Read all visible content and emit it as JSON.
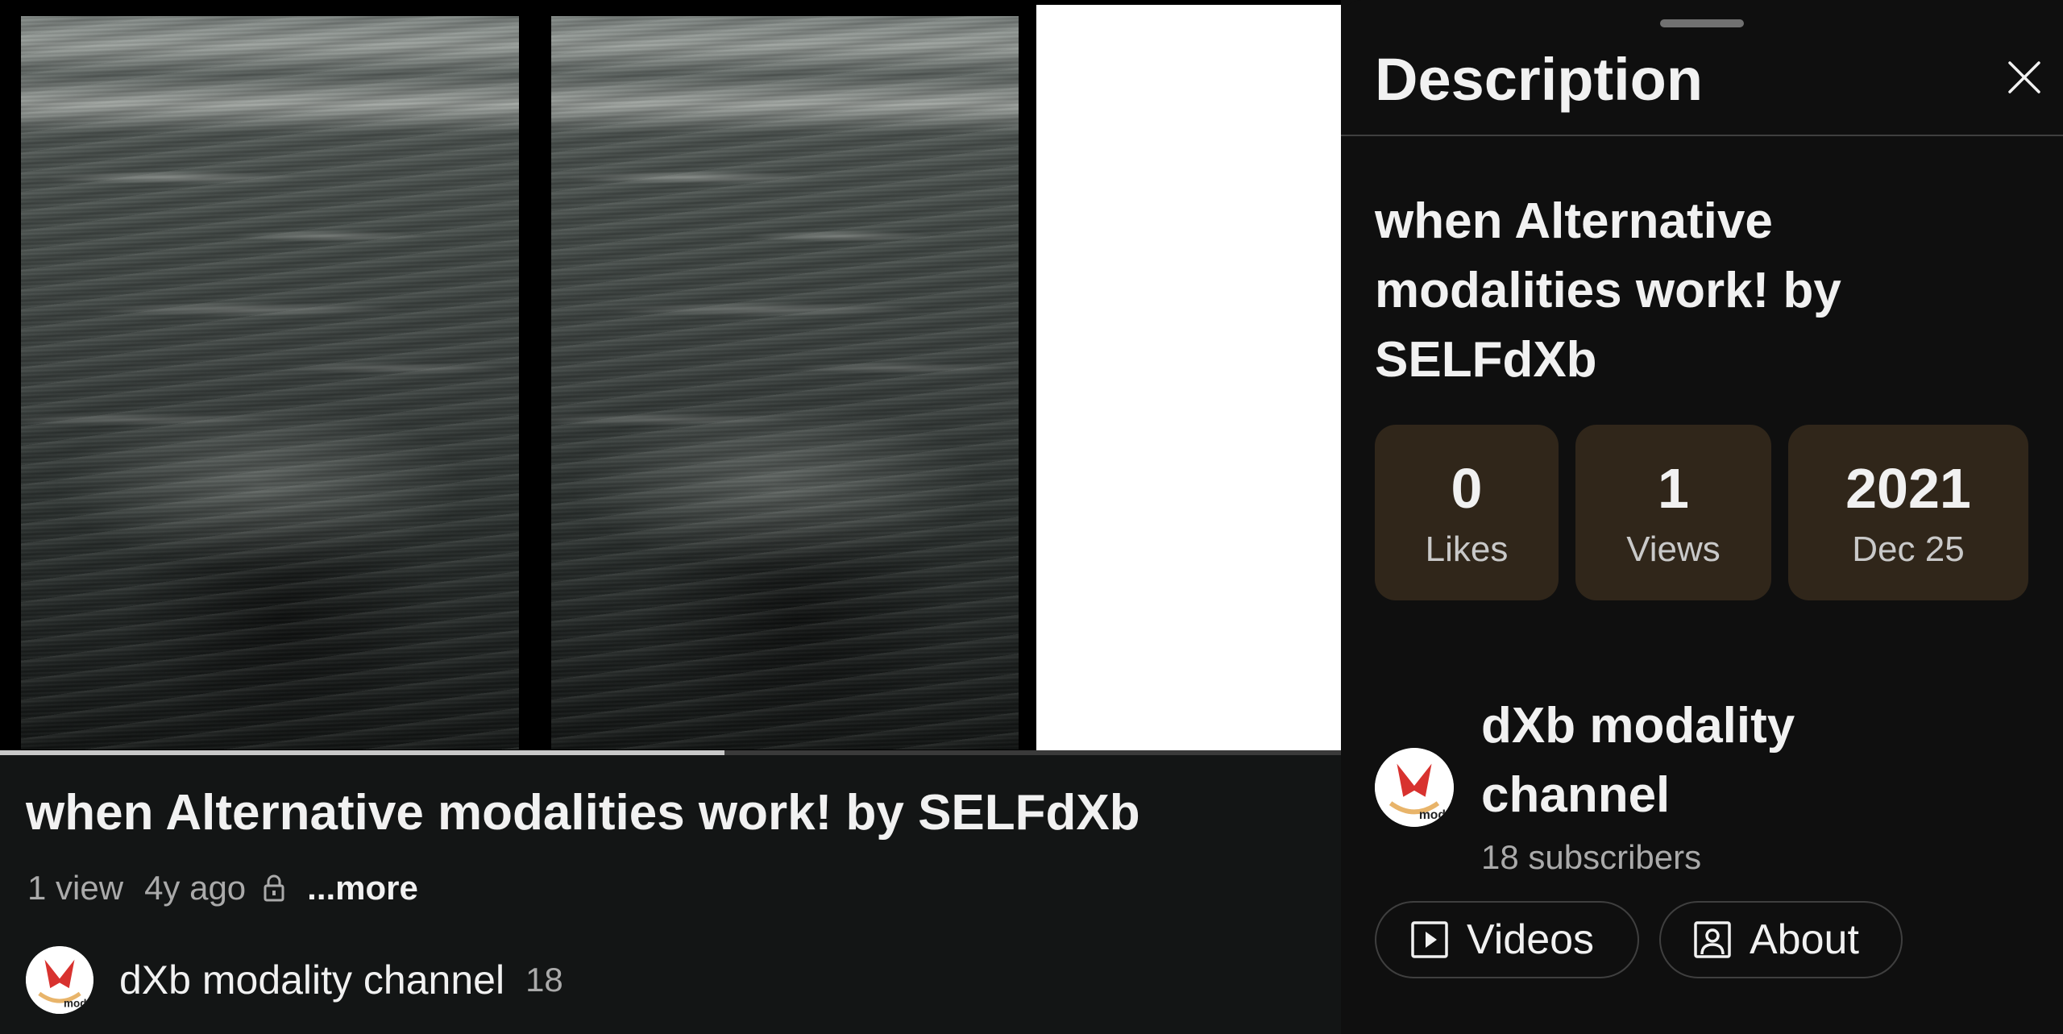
{
  "player": {
    "progress_fraction": 0.54
  },
  "video": {
    "title": "when Alternative modalities work! by SELFdXb",
    "views": "1 view",
    "age": "4y ago",
    "more_label": "...more",
    "lock_icon": "lock-icon"
  },
  "channel": {
    "name": "dXb modality channel",
    "subscriber_count_short": "18",
    "subscribers": "18 subscribers",
    "avatar_text": "moda"
  },
  "description_panel": {
    "title": "Description",
    "close_icon": "close-icon",
    "video_title": "when Alternative modalities work! by SELFdXb",
    "stats": [
      {
        "value": "0",
        "label": "Likes"
      },
      {
        "value": "1",
        "label": "Views"
      },
      {
        "value": "2021",
        "label": "Dec 25"
      }
    ],
    "buttons": {
      "videos_label": "Videos",
      "about_label": "About"
    }
  },
  "colors": {
    "background": "#0f0f0f",
    "stat_card": "#30261a",
    "text_primary": "#f1f1f1",
    "text_secondary": "#aaaaaa"
  }
}
